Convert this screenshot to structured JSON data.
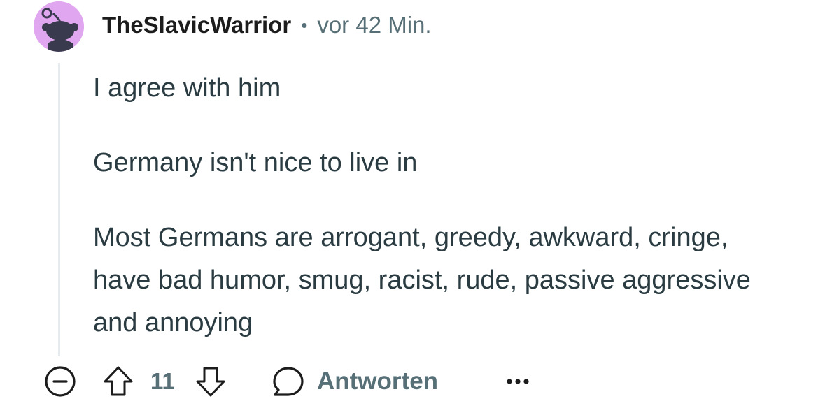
{
  "comment": {
    "author": "TheSlavicWarrior",
    "separator": "•",
    "timestamp": "vor 42 Min.",
    "avatar_icon": "reddit-snoo-avatar-icon",
    "avatar_color": "#e1a6f0",
    "paragraphs": [
      "I agree with him",
      "Germany isn't nice to live in",
      "Most Germans are arrogant, greedy, awkward, cringe, have bad humor, smug, racist, rude, passive aggressive and annoying"
    ]
  },
  "actions": {
    "collapse_icon": "minus-circle-icon",
    "upvote_icon": "arrow-up-icon",
    "vote_count": "11",
    "downvote_icon": "arrow-down-icon",
    "reply_icon": "speech-bubble-icon",
    "reply_label": "Antworten",
    "more_icon": "ellipsis-icon"
  },
  "colors": {
    "meta_text": "#576f76",
    "body_text": "#2a3c42",
    "thread_line": "#e5ebee"
  }
}
